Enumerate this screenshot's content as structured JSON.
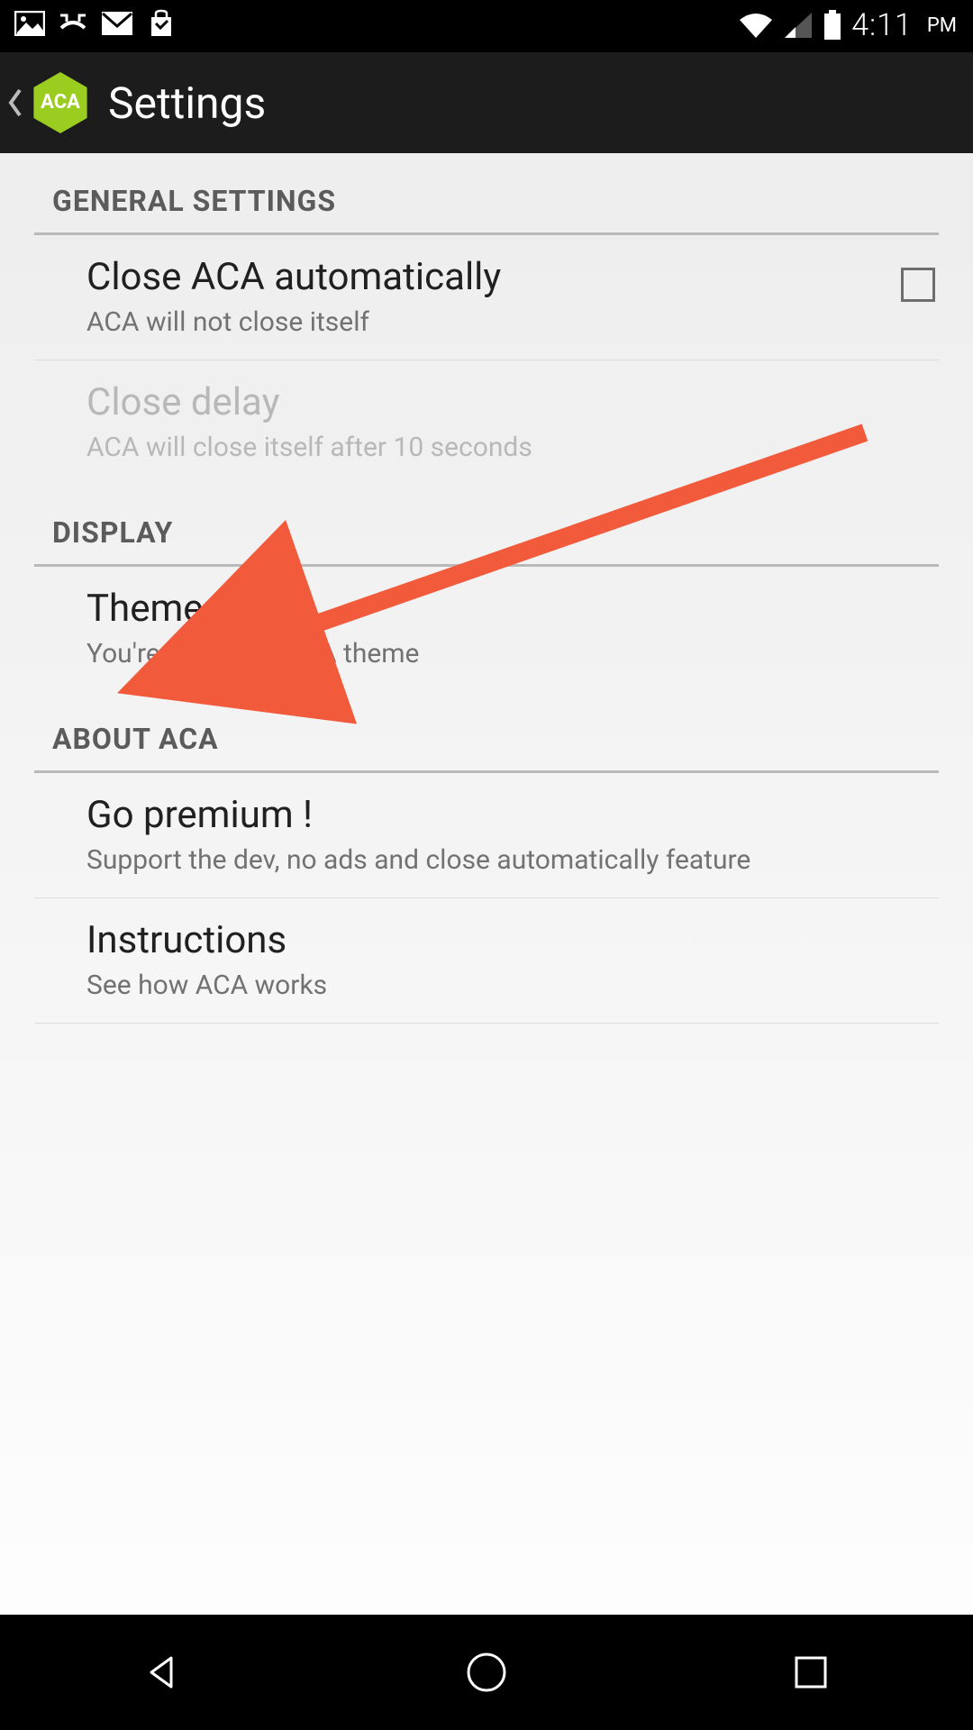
{
  "status": {
    "time": "4:11",
    "ampm": "PM"
  },
  "actionbar": {
    "title": "Settings",
    "app_badge": "ACA"
  },
  "sections": {
    "general": {
      "header": "GENERAL SETTINGS",
      "close_auto": {
        "title": "Close ACA automatically",
        "sub": "ACA will not close itself"
      },
      "close_delay": {
        "title": "Close delay",
        "sub": "ACA will close itself after 10 seconds"
      }
    },
    "display": {
      "header": "DISPLAY",
      "theme": {
        "title": "Theme",
        "sub": "You're using the ACA theme"
      }
    },
    "about": {
      "header": "ABOUT ACA",
      "premium": {
        "title": "Go premium !",
        "sub": "Support the dev, no ads and close automatically feature"
      },
      "instructions": {
        "title": "Instructions",
        "sub": "See how ACA works"
      }
    }
  }
}
